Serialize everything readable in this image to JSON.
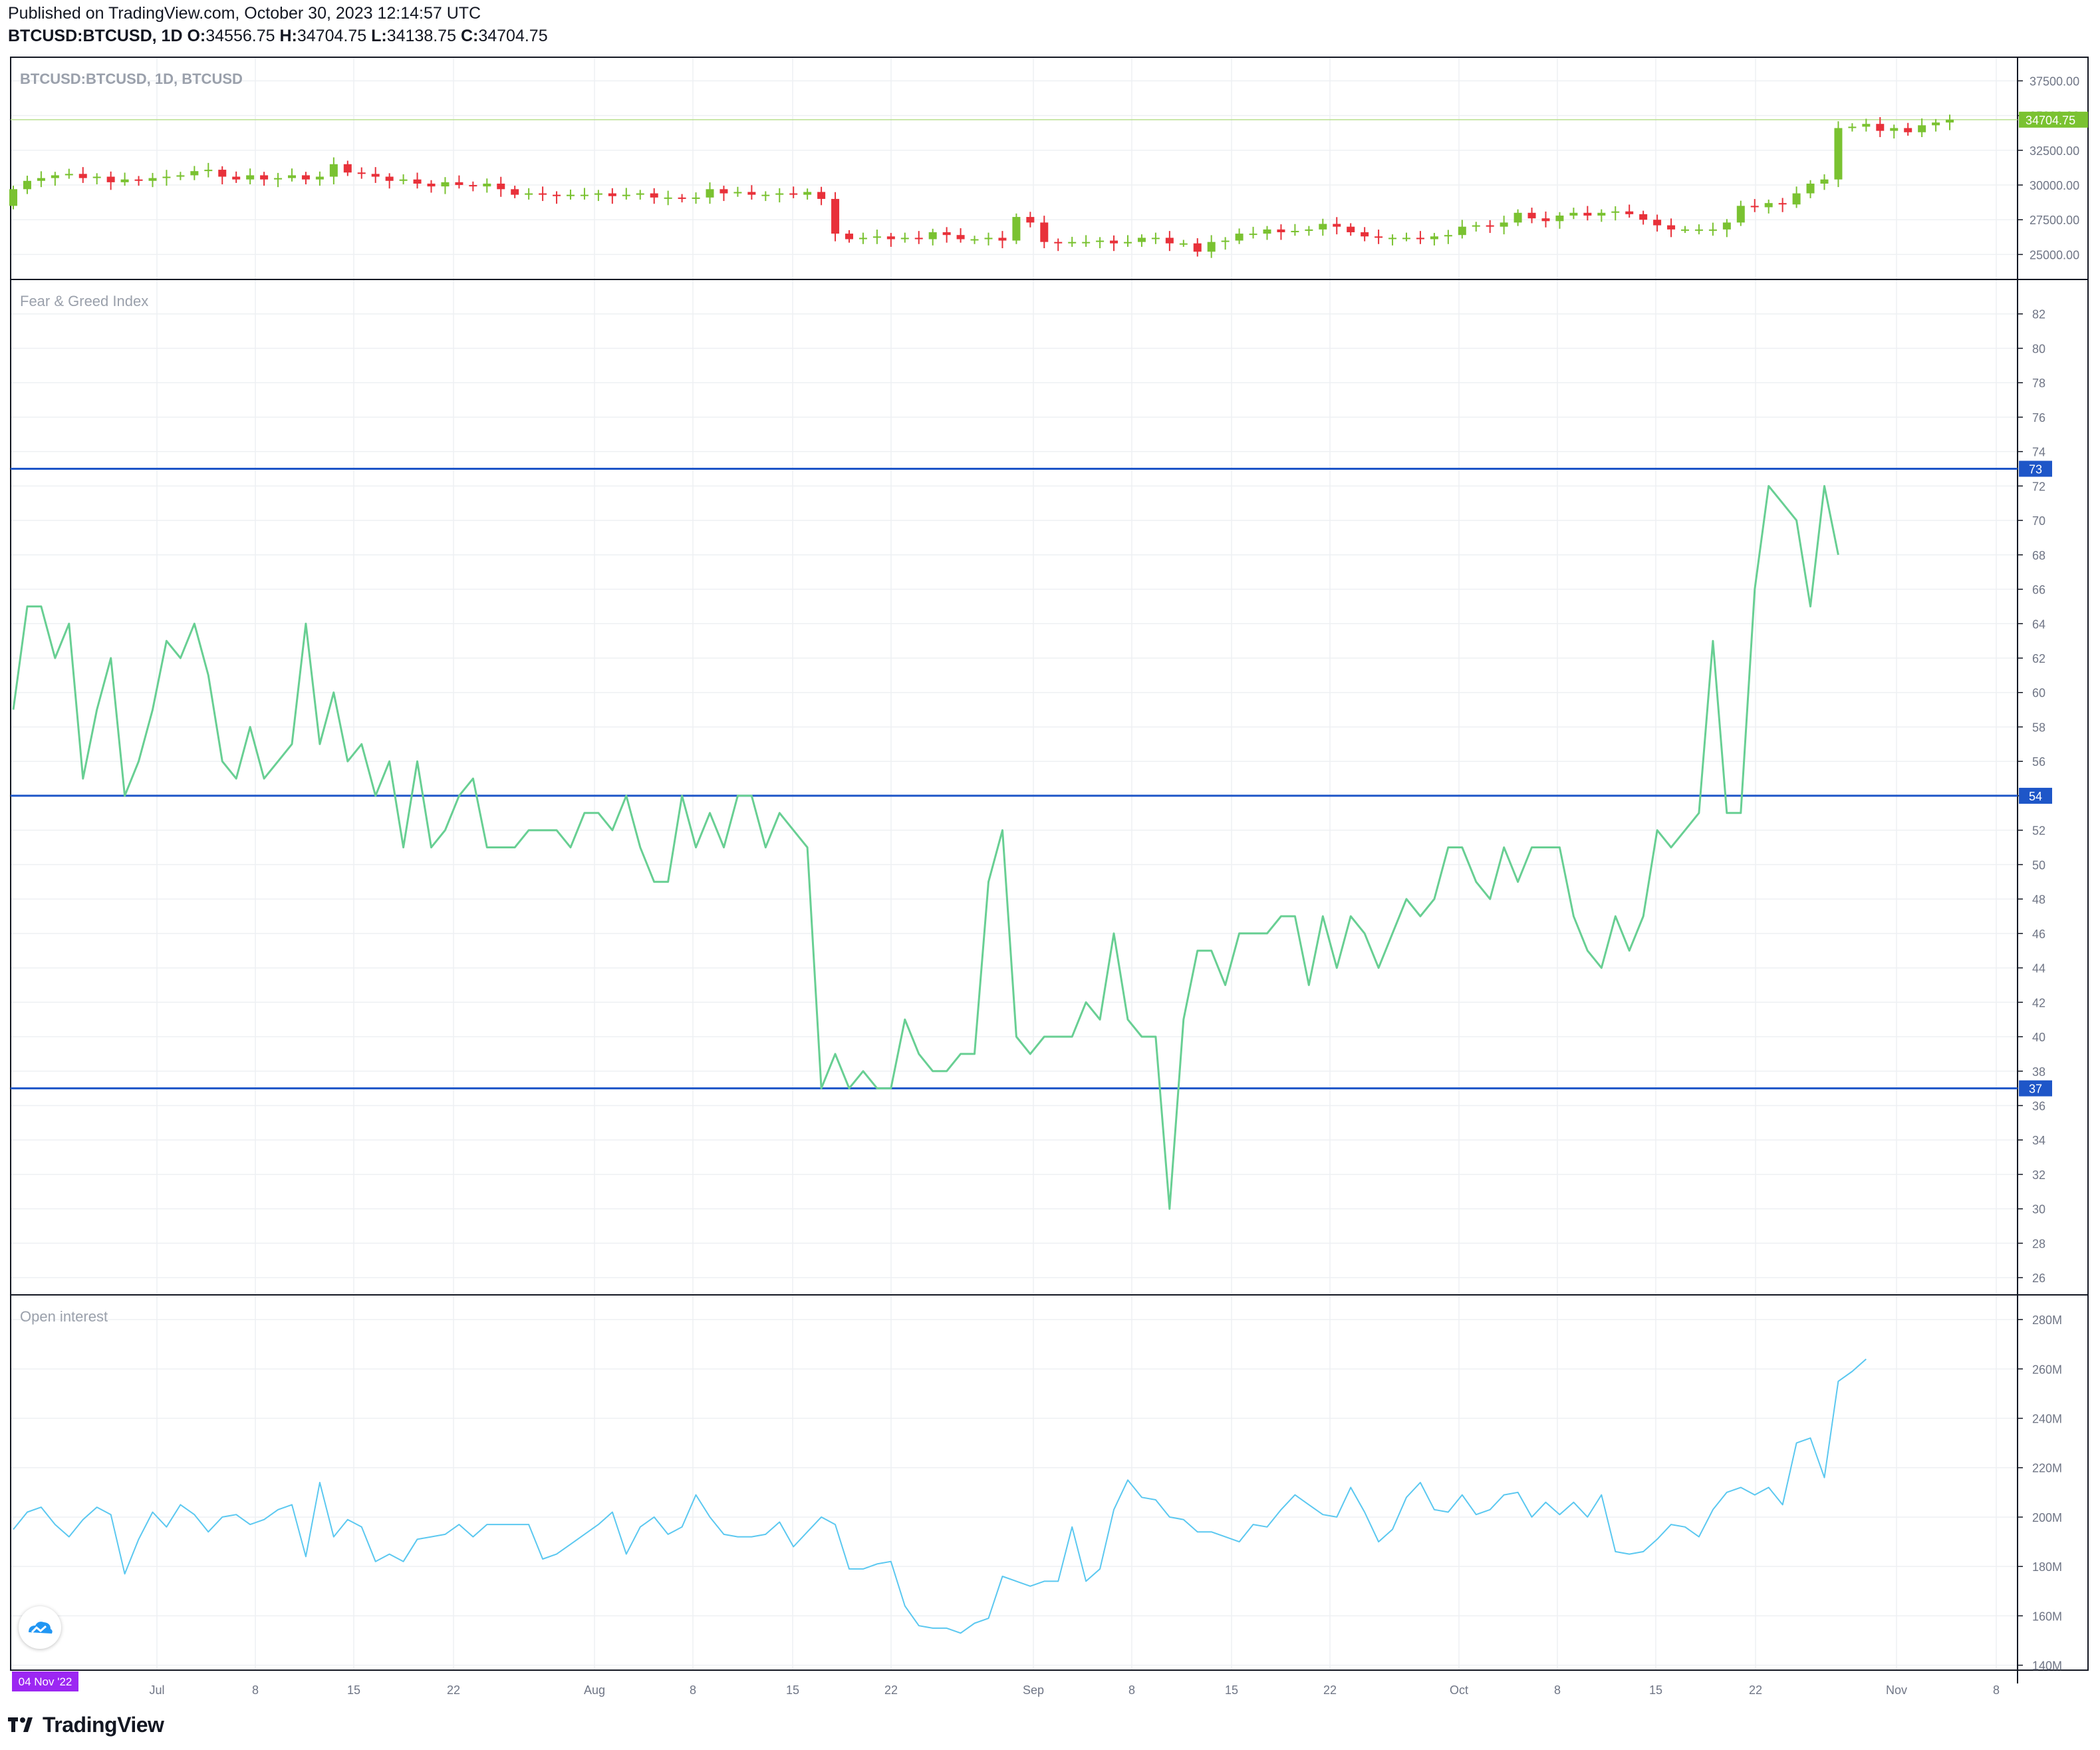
{
  "header": {
    "published": "Published on TradingView.com, October 30, 2023 12:14:57 UTC",
    "symbol": "BTCUSD:BTCUSD, 1D",
    "o_label": "O:",
    "o_value": "34556.75",
    "h_label": "H:",
    "h_value": "34704.75",
    "l_label": "L:",
    "l_value": "34138.75",
    "c_label": "C:",
    "c_value": "34704.75"
  },
  "panes": {
    "price_label": "BTCUSD:BTCUSD, 1D, BTCUSD",
    "fear_label": "Fear & Greed Index",
    "oi_label": "Open interest"
  },
  "brand": {
    "name": "TradingView",
    "logo_icon": "tradingview-logo-icon"
  },
  "colors": {
    "up": "#7ac231",
    "down": "#e8313a",
    "fng": "#68cf93",
    "oi": "#5bc8f0",
    "level": "#1e56c8",
    "last_price": "#7ac231",
    "date_badge": "#9c27f2"
  },
  "chart_data": [
    {
      "type": "candlestick",
      "title": "BTCUSD:BTCUSD, 1D, BTCUSD",
      "last_price": "34704.75",
      "price_ticks": [
        "25000.00",
        "27500.00",
        "30000.00",
        "32500.00",
        "35000.00",
        "37500.00"
      ],
      "ylim": [
        23200,
        39200
      ],
      "x_ticks": [
        "Jul",
        "8",
        "15",
        "22",
        "Aug",
        "8",
        "15",
        "22",
        "Sep",
        "8",
        "15",
        "22",
        "Oct",
        "8",
        "15",
        "22",
        "Nov",
        "8"
      ],
      "cursor_date": "04 Nov '22",
      "close": [
        29700,
        30300,
        30500,
        30700,
        30800,
        30500,
        30600,
        30200,
        30400,
        30300,
        30500,
        30600,
        30700,
        31000,
        31100,
        30600,
        30400,
        30700,
        30400,
        30500,
        30700,
        30400,
        30600,
        31500,
        30900,
        30800,
        30600,
        30300,
        30400,
        30100,
        29900,
        30200,
        30000,
        29900,
        30100,
        29700,
        29300,
        29400,
        29300,
        29200,
        29300,
        29300,
        29400,
        29200,
        29300,
        29400,
        29100,
        29100,
        29000,
        29100,
        29700,
        29400,
        29500,
        29300,
        29300,
        29400,
        29300,
        29500,
        29000,
        26500,
        26100,
        26200,
        26300,
        26100,
        26200,
        26100,
        26600,
        26400,
        26100,
        26100,
        26200,
        26000,
        27700,
        27300,
        25900,
        25800,
        25900,
        25900,
        26000,
        25800,
        25900,
        26200,
        26200,
        25800,
        25800,
        25200,
        25900,
        26000,
        26500,
        26500,
        26800,
        26600,
        26700,
        26800,
        27200,
        27000,
        26600,
        26300,
        26200,
        26200,
        26200,
        26100,
        26300,
        26400,
        27000,
        27100,
        27000,
        27300,
        28000,
        27600,
        27400,
        27800,
        28000,
        27800,
        28000,
        28100,
        27900,
        27500,
        27100,
        26800,
        26800,
        26800,
        26800,
        27300,
        28500,
        28400,
        28700,
        28600,
        29400,
        30100,
        30400,
        34100,
        34200,
        34400,
        33900,
        34100,
        33800,
        34300,
        34500,
        34700
      ],
      "fear_greed": {
        "title": "Fear & Greed Index",
        "levels": [
          73,
          54,
          37
        ],
        "y_ticks": [
          26,
          28,
          30,
          32,
          34,
          36,
          38,
          40,
          42,
          44,
          46,
          48,
          50,
          52,
          54,
          56,
          58,
          60,
          62,
          64,
          66,
          68,
          70,
          72,
          74,
          76,
          78,
          80,
          82
        ],
        "ylim": [
          25,
          84
        ],
        "values": [
          59,
          65,
          65,
          62,
          64,
          55,
          59,
          62,
          54,
          56,
          59,
          63,
          62,
          64,
          61,
          56,
          55,
          58,
          55,
          56,
          57,
          64,
          57,
          60,
          56,
          57,
          54,
          56,
          51,
          56,
          51,
          52,
          54,
          55,
          51,
          51,
          51,
          52,
          52,
          52,
          51,
          53,
          53,
          52,
          54,
          51,
          49,
          49,
          54,
          51,
          53,
          51,
          54,
          54,
          51,
          53,
          52,
          51,
          37,
          39,
          37,
          38,
          37,
          37,
          41,
          39,
          38,
          38,
          39,
          39,
          49,
          52,
          40,
          39,
          40,
          40,
          40,
          42,
          41,
          46,
          41,
          40,
          40,
          30,
          41,
          45,
          45,
          43,
          46,
          46,
          46,
          47,
          47,
          43,
          47,
          44,
          47,
          46,
          44,
          46,
          48,
          47,
          48,
          51,
          51,
          49,
          48,
          51,
          49,
          51,
          51,
          51,
          47,
          45,
          44,
          47,
          45,
          47,
          52,
          51,
          52,
          53,
          63,
          53,
          53,
          66,
          72,
          71,
          70,
          65,
          72,
          68
        ]
      },
      "open_interest": {
        "title": "Open interest",
        "y_ticks": [
          "140M",
          "160M",
          "180M",
          "200M",
          "220M",
          "240M",
          "260M",
          "280M"
        ],
        "ylim": [
          138,
          290
        ],
        "unit": "M",
        "values": [
          195,
          202,
          204,
          197,
          192,
          199,
          204,
          201,
          177,
          191,
          202,
          196,
          205,
          201,
          194,
          200,
          201,
          197,
          199,
          203,
          205,
          184,
          214,
          192,
          199,
          196,
          182,
          185,
          182,
          191,
          192,
          193,
          197,
          192,
          197,
          197,
          197,
          197,
          183,
          185,
          189,
          193,
          197,
          202,
          185,
          196,
          200,
          193,
          196,
          209,
          200,
          193,
          192,
          192,
          193,
          198,
          188,
          194,
          200,
          197,
          179,
          179,
          181,
          182,
          164,
          156,
          155,
          155,
          153,
          157,
          159,
          176,
          174,
          172,
          174,
          174,
          196,
          174,
          179,
          203,
          215,
          208,
          207,
          200,
          199,
          194,
          194,
          192,
          190,
          197,
          196,
          203,
          209,
          205,
          201,
          200,
          212,
          202,
          190,
          195,
          208,
          214,
          203,
          202,
          209,
          201,
          203,
          209,
          210,
          200,
          206,
          201,
          206,
          200,
          209,
          186,
          185,
          186,
          191,
          197,
          196,
          192,
          203,
          210,
          212,
          209,
          212,
          205,
          230,
          232,
          216,
          255,
          259,
          264
        ]
      }
    }
  ]
}
